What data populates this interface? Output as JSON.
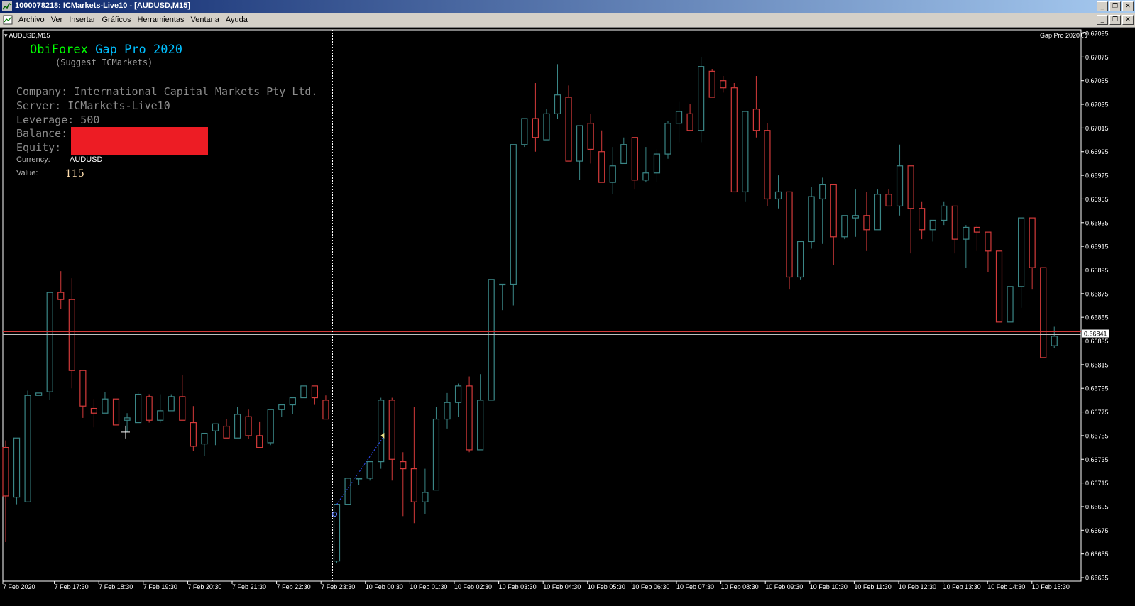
{
  "window": {
    "title": "1000078218: ICMarkets-Live10 - [AUDUSD,M15]"
  },
  "menu": {
    "items": [
      "Archivo",
      "Ver",
      "Insertar",
      "Gráficos",
      "Herramientas",
      "Ventana",
      "Ayuda"
    ]
  },
  "chart": {
    "symbol_label": "AUDUSD,M15",
    "indicator_name": "Gap Pro 2020",
    "current_price": "0.66841",
    "colors": {
      "background": "#000000",
      "bull_candle": "#3a8686",
      "bear_candle": "#d43a3a",
      "price_line": "#d43a3a",
      "grid_text": "#ffffff"
    }
  },
  "overlay": {
    "brand_part1": "ObiForex",
    "brand_part2": "Gap Pro 2020",
    "suggest": "(Suggest ICMarkets)",
    "company": "Company: International Capital Markets Pty Ltd.",
    "server": "Server: ICMarkets-Live10",
    "leverage": "Leverage: 500",
    "balance_label": "Balance:",
    "equity_label": "Equity:",
    "currency_label": "Currency:",
    "currency_value": "AUDUSD",
    "value_label": "Value:",
    "value_number": "115"
  },
  "chart_data": {
    "type": "candlestick",
    "y_axis_ticks": [
      "0.67095",
      "0.67075",
      "0.67055",
      "0.67035",
      "0.67015",
      "0.66995",
      "0.66975",
      "0.66955",
      "0.66935",
      "0.66915",
      "0.66895",
      "0.66875",
      "0.66855",
      "0.66835",
      "0.66815",
      "0.66795",
      "0.66775",
      "0.66755",
      "0.66735",
      "0.66715",
      "0.66695",
      "0.66675",
      "0.66655",
      "0.66635"
    ],
    "ylim": [
      0.66632,
      0.67098
    ],
    "x_axis_ticks": [
      "7 Feb 2020",
      "7 Feb 17:30",
      "7 Feb 18:30",
      "7 Feb 19:30",
      "7 Feb 20:30",
      "7 Feb 21:30",
      "7 Feb 22:30",
      "7 Feb 23:30",
      "10 Feb 00:30",
      "10 Feb 01:30",
      "10 Feb 02:30",
      "10 Feb 03:30",
      "10 Feb 04:30",
      "10 Feb 05:30",
      "10 Feb 06:30",
      "10 Feb 07:30",
      "10 Feb 08:30",
      "10 Feb 09:30",
      "10 Feb 10:30",
      "10 Feb 11:30",
      "10 Feb 12:30",
      "10 Feb 13:30",
      "10 Feb 14:30",
      "10 Feb 15:30"
    ],
    "candles": [
      [
        0.66745,
        0.66751,
        0.66665,
        0.66704
      ],
      [
        0.66703,
        0.66753,
        0.66697,
        0.66753
      ],
      [
        0.66699,
        0.66793,
        0.66699,
        0.66789
      ],
      [
        0.66789,
        0.66791,
        0.66789,
        0.66791
      ],
      [
        0.66792,
        0.66876,
        0.66785,
        0.66876
      ],
      [
        0.66876,
        0.66894,
        0.66862,
        0.6687
      ],
      [
        0.6687,
        0.66888,
        0.66795,
        0.6681
      ],
      [
        0.6681,
        0.6681,
        0.6677,
        0.6678
      ],
      [
        0.66778,
        0.66786,
        0.66762,
        0.66774
      ],
      [
        0.66774,
        0.66792,
        0.66774,
        0.66786
      ],
      [
        0.66786,
        0.66786,
        0.6676,
        0.66764
      ],
      [
        0.66768,
        0.66774,
        0.66758,
        0.6677
      ],
      [
        0.66766,
        0.66792,
        0.66766,
        0.6679
      ],
      [
        0.66788,
        0.6679,
        0.66766,
        0.66768
      ],
      [
        0.66768,
        0.6679,
        0.66766,
        0.66776
      ],
      [
        0.66776,
        0.6679,
        0.66776,
        0.66788
      ],
      [
        0.66788,
        0.66806,
        0.66768,
        0.66768
      ],
      [
        0.66766,
        0.6678,
        0.66742,
        0.66746
      ],
      [
        0.66748,
        0.66757,
        0.66738,
        0.66757
      ],
      [
        0.66759,
        0.66765,
        0.66747,
        0.66765
      ],
      [
        0.66763,
        0.66769,
        0.66756,
        0.66753
      ],
      [
        0.66753,
        0.66779,
        0.66753,
        0.66773
      ],
      [
        0.66771,
        0.66777,
        0.66752,
        0.66755
      ],
      [
        0.66755,
        0.66767,
        0.66745,
        0.66745
      ],
      [
        0.66749,
        0.66777,
        0.66747,
        0.66777
      ],
      [
        0.66777,
        0.66781,
        0.66771,
        0.66781
      ],
      [
        0.66781,
        0.66787,
        0.66773,
        0.66787
      ],
      [
        0.66787,
        0.66797,
        0.66787,
        0.66797
      ],
      [
        0.66797,
        0.66797,
        0.66781,
        0.66787
      ],
      [
        0.66785,
        0.66789,
        0.66769,
        0.66769
      ],
      [
        0.66649,
        0.66697,
        0.66647,
        0.66697
      ],
      [
        0.66697,
        0.66719,
        0.66697,
        0.66719
      ],
      [
        0.66719,
        0.66719,
        0.66713,
        0.66719
      ],
      [
        0.66719,
        0.66733,
        0.66717,
        0.66733
      ],
      [
        0.66733,
        0.66787,
        0.66727,
        0.66785
      ],
      [
        0.66785,
        0.66787,
        0.66717,
        0.66735
      ],
      [
        0.66733,
        0.66741,
        0.66687,
        0.66727
      ],
      [
        0.66727,
        0.66779,
        0.66681,
        0.66699
      ],
      [
        0.66699,
        0.66727,
        0.66689,
        0.66707
      ],
      [
        0.66709,
        0.66779,
        0.66709,
        0.66769
      ],
      [
        0.66769,
        0.66791,
        0.66761,
        0.66783
      ],
      [
        0.66783,
        0.66799,
        0.66771,
        0.66797
      ],
      [
        0.66797,
        0.66805,
        0.66741,
        0.66743
      ],
      [
        0.66743,
        0.66807,
        0.66743,
        0.66785
      ],
      [
        0.66785,
        0.66887,
        0.66785,
        0.66887
      ],
      [
        0.66883,
        0.66883,
        0.66861,
        0.66883
      ],
      [
        0.66883,
        0.66959,
        0.66865,
        0.67001
      ],
      [
        0.67001,
        0.67023,
        0.66999,
        0.67023
      ],
      [
        0.67023,
        0.67053,
        0.66995,
        0.67007
      ],
      [
        0.67005,
        0.67031,
        0.67005,
        0.67027
      ],
      [
        0.67027,
        0.67069,
        0.67023,
        0.67043
      ],
      [
        0.67041,
        0.67051,
        0.67017,
        0.66987
      ],
      [
        0.66987,
        0.67017,
        0.66971,
        0.67017
      ],
      [
        0.67019,
        0.67027,
        0.66985,
        0.66997
      ],
      [
        0.66995,
        0.67013,
        0.66975,
        0.66969
      ],
      [
        0.66969,
        0.66999,
        0.66959,
        0.66983
      ],
      [
        0.66985,
        0.67007,
        0.66985,
        0.67001
      ],
      [
        0.67007,
        0.67007,
        0.66963,
        0.66971
      ],
      [
        0.66971,
        0.66999,
        0.66969,
        0.66977
      ],
      [
        0.66977,
        0.66997,
        0.66969,
        0.66993
      ],
      [
        0.66993,
        0.67021,
        0.66989,
        0.67019
      ],
      [
        0.67019,
        0.67037,
        0.67003,
        0.67029
      ],
      [
        0.67027,
        0.67035,
        0.67019,
        0.67013
      ],
      [
        0.67013,
        0.67075,
        0.67003,
        0.67067
      ],
      [
        0.67063,
        0.67065,
        0.67041,
        0.67041
      ],
      [
        0.67055,
        0.67059,
        0.67045,
        0.67049
      ],
      [
        0.67049,
        0.67053,
        0.67045,
        0.66961
      ],
      [
        0.66961,
        0.67029,
        0.66953,
        0.67029
      ],
      [
        0.67031,
        0.67059,
        0.67007,
        0.67013
      ],
      [
        0.67013,
        0.67019,
        0.66949,
        0.66955
      ],
      [
        0.66955,
        0.66975,
        0.66947,
        0.66961
      ],
      [
        0.66961,
        0.66959,
        0.66879,
        0.66889
      ],
      [
        0.66889,
        0.66919,
        0.66887,
        0.66919
      ],
      [
        0.66919,
        0.66965,
        0.66913,
        0.66957
      ],
      [
        0.66955,
        0.66973,
        0.66917,
        0.66967
      ],
      [
        0.66967,
        0.66967,
        0.66899,
        0.66923
      ],
      [
        0.66923,
        0.66941,
        0.66921,
        0.66941
      ],
      [
        0.66939,
        0.66963,
        0.66923,
        0.66941
      ],
      [
        0.66941,
        0.66961,
        0.66911,
        0.66929
      ],
      [
        0.66929,
        0.66963,
        0.66929,
        0.66959
      ],
      [
        0.66959,
        0.66963,
        0.66949,
        0.66949
      ],
      [
        0.66949,
        0.67001,
        0.66941,
        0.66983
      ],
      [
        0.66983,
        0.66983,
        0.66909,
        0.66947
      ],
      [
        0.66947,
        0.66953,
        0.66921,
        0.66929
      ],
      [
        0.66929,
        0.66937,
        0.66919,
        0.66937
      ],
      [
        0.66937,
        0.66953,
        0.66933,
        0.66949
      ],
      [
        0.66949,
        0.66949,
        0.66909,
        0.66921
      ],
      [
        0.66921,
        0.66933,
        0.66897,
        0.66931
      ],
      [
        0.66931,
        0.66933,
        0.66911,
        0.66927
      ],
      [
        0.66927,
        0.66927,
        0.66893,
        0.66911
      ],
      [
        0.66911,
        0.66915,
        0.66835,
        0.66851
      ],
      [
        0.66851,
        0.66881,
        0.66851,
        0.66881
      ],
      [
        0.66881,
        0.66939,
        0.66863,
        0.66939
      ],
      [
        0.66939,
        0.66939,
        0.66879,
        0.66897
      ],
      [
        0.66897,
        0.66897,
        0.66837,
        0.66821
      ],
      [
        0.66831,
        0.66847,
        0.66829,
        0.66839
      ]
    ]
  }
}
